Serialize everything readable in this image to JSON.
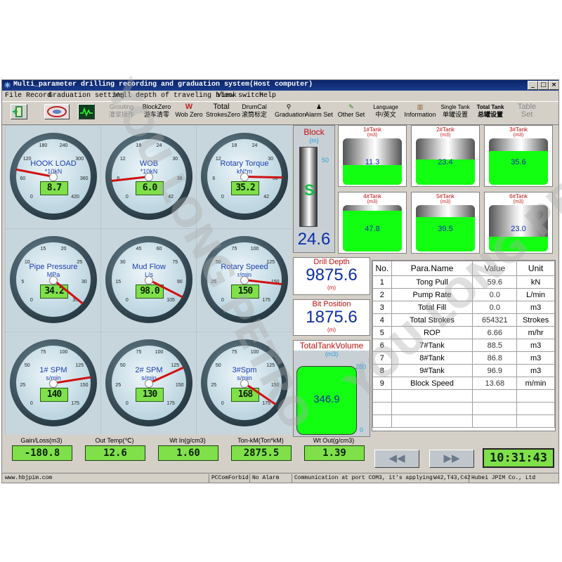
{
  "window": {
    "title": "Multi_parameter drilling recording and graduation system(Host computer)",
    "controls": [
      "_",
      "□",
      "×"
    ]
  },
  "menu": [
    "File Record",
    "Graduation setting",
    "Well depth of traveling block",
    "View switch",
    "Help"
  ],
  "toolbar": {
    "grouting": {
      "l1": "Grouting",
      "l2": "灌浆操作"
    },
    "blockzero": {
      "l1": "BlockZero",
      "l2": "游车清零"
    },
    "wobzero": {
      "l1": "Wob Zero"
    },
    "totalstrokes": {
      "l1": "Total",
      "l2": "StrokesZero"
    },
    "drumcal": {
      "l1": "DrumCal",
      "l2": "滚筒标定"
    },
    "graduation": {
      "l1": "Graduation"
    },
    "alarmset": {
      "l1": "Alarm Set"
    },
    "otherset": {
      "l1": "Other Set"
    },
    "language": {
      "l1": "Language",
      "l2": "中/英文"
    },
    "information": {
      "l1": "Information"
    },
    "singletank": {
      "l1": "Single Tank",
      "l2": "单罐设置"
    },
    "totaltank": {
      "l1": "Total Tank",
      "l2": "总罐设置"
    },
    "tableset": {
      "l1": "Table",
      "l2": "Set"
    }
  },
  "gauges": [
    {
      "label": "HOOK LOAD",
      "unit": "*10kN",
      "value": "8.7",
      "ticks": [
        "0",
        "60",
        "120",
        "180",
        "240",
        "300",
        "360",
        "420"
      ],
      "min": 0,
      "max": 420,
      "reading": 87
    },
    {
      "label": "WOB",
      "unit": "*10kN",
      "value": "6.0",
      "ticks": [
        "0",
        "6",
        "12",
        "18",
        "24",
        "30",
        "36",
        "42"
      ],
      "min": 0,
      "max": 42,
      "reading": 6
    },
    {
      "label": "Rotary Torque",
      "unit": "kN*m",
      "value": "35.2",
      "ticks": [
        "0",
        "6",
        "12",
        "18",
        "24",
        "30",
        "36",
        "42"
      ],
      "min": 0,
      "max": 42,
      "reading": 35.2
    },
    {
      "label": "Pipe Pressure",
      "unit": "MPa",
      "value": "34.2",
      "ticks": [
        "0",
        "5",
        "10",
        "15",
        "20",
        "25",
        "30",
        "35"
      ],
      "min": 0,
      "max": 35,
      "reading": 34.2
    },
    {
      "label": "Mud Flow",
      "unit": "L/s",
      "value": "98.0",
      "ticks": [
        "0",
        "15",
        "30",
        "45",
        "60",
        "75",
        "90",
        "105"
      ],
      "min": 0,
      "max": 105,
      "reading": 98
    },
    {
      "label": "Rotary Speed",
      "unit": "r/min",
      "value": "150",
      "ticks": [
        "0",
        "25",
        "50",
        "75",
        "100",
        "125",
        "150",
        "175"
      ],
      "min": 0,
      "max": 175,
      "reading": 150
    },
    {
      "label": "1# SPM",
      "unit": "s/min",
      "value": "140",
      "ticks": [
        "0",
        "25",
        "50",
        "75",
        "100",
        "125",
        "150",
        "175"
      ],
      "min": 0,
      "max": 175,
      "reading": 140
    },
    {
      "label": "2# SPM",
      "unit": "s/min",
      "value": "130",
      "ticks": [
        "0",
        "25",
        "50",
        "75",
        "100",
        "125",
        "150",
        "175"
      ],
      "min": 0,
      "max": 175,
      "reading": 130
    },
    {
      "label": "3#Spm",
      "unit": "s/min",
      "value": "168",
      "ticks": [
        "0",
        "25",
        "50",
        "75",
        "100",
        "125",
        "150",
        "175"
      ],
      "min": 0,
      "max": 175,
      "reading": 168
    }
  ],
  "block": {
    "title": "Block",
    "unit": "(m)",
    "value": "24.6",
    "scale_top": "50"
  },
  "tanks": [
    {
      "title": "1#Tank",
      "unit": "(m3)",
      "value": "11.3",
      "fill": 0.42
    },
    {
      "title": "2#Tank",
      "unit": "(m3)",
      "value": "23.4",
      "fill": 0.55
    },
    {
      "title": "3#Tank",
      "unit": "(m3)",
      "value": "35.6",
      "fill": 0.72
    },
    {
      "title": "4#Tank",
      "unit": "(m3)",
      "value": "47.8",
      "fill": 0.88
    },
    {
      "title": "5#Tank",
      "unit": "(m3)",
      "value": "39.5",
      "fill": 0.75
    },
    {
      "title": "6#Tank",
      "unit": "(m3)",
      "value": "23.0",
      "fill": 0.32
    }
  ],
  "drill_depth": {
    "title": "Drill Depth",
    "value": "9875.6",
    "unit": "(m)"
  },
  "bit_position": {
    "title": "Bit Position",
    "value": "1875.6",
    "unit": "(m)"
  },
  "total_tank_volume": {
    "title": "TotalTankVolume",
    "unit": "(m3)",
    "value": "346.9",
    "scale_top": "280",
    "scale_bottom": "0"
  },
  "param_table": {
    "headers": [
      "No.",
      "Para.Name",
      "Value",
      "Unit"
    ],
    "rows": [
      [
        "1",
        "Tong Pull",
        "59.6",
        "kN"
      ],
      [
        "2",
        "Pump Rate",
        "0.0",
        "L/min"
      ],
      [
        "3",
        "Total Fill",
        "0.0",
        "m3"
      ],
      [
        "4",
        "Total Strokes",
        "654321",
        "Strokes"
      ],
      [
        "5",
        "ROP",
        "6.66",
        "m/hr"
      ],
      [
        "6",
        "7#Tank",
        "88.5",
        "m3"
      ],
      [
        "7",
        "8#Tank",
        "86.8",
        "m3"
      ],
      [
        "8",
        "9#Tank",
        "96.9",
        "m3"
      ],
      [
        "9",
        "Block Speed",
        "13.68",
        "m/min"
      ]
    ]
  },
  "bottom_readouts": [
    {
      "label": "Gain/Loss(m3)",
      "value": "-180.8"
    },
    {
      "label": "Out Temp(℃)",
      "value": "12.6"
    },
    {
      "label": "Wt In(g/cm3)",
      "value": "1.60"
    },
    {
      "label": "Ton-kM(Ton*kM)",
      "value": "2875.5"
    },
    {
      "label": "Wt Out(g/cm3)",
      "value": "1.39"
    }
  ],
  "nav": {
    "prev": "◀◀",
    "next": "▶▶"
  },
  "clock": "10:31:43",
  "statusbar": {
    "site": "www.hbjpim.com",
    "comm_status": "PCComForbid",
    "alarm": "No Alarm",
    "comm_info": "Communication at port COM3, it's applying",
    "models": "W42,T43,C42",
    "company": "Hubei JPIM Co., Ltd"
  },
  "watermark": "YOU LONG PETRO",
  "colors": {
    "lcd_green": "#7fe04a",
    "tank_green": "#12ff12",
    "title_blue": "#0a246a",
    "value_blue": "#0b2ea8",
    "label_red": "#c01010"
  }
}
